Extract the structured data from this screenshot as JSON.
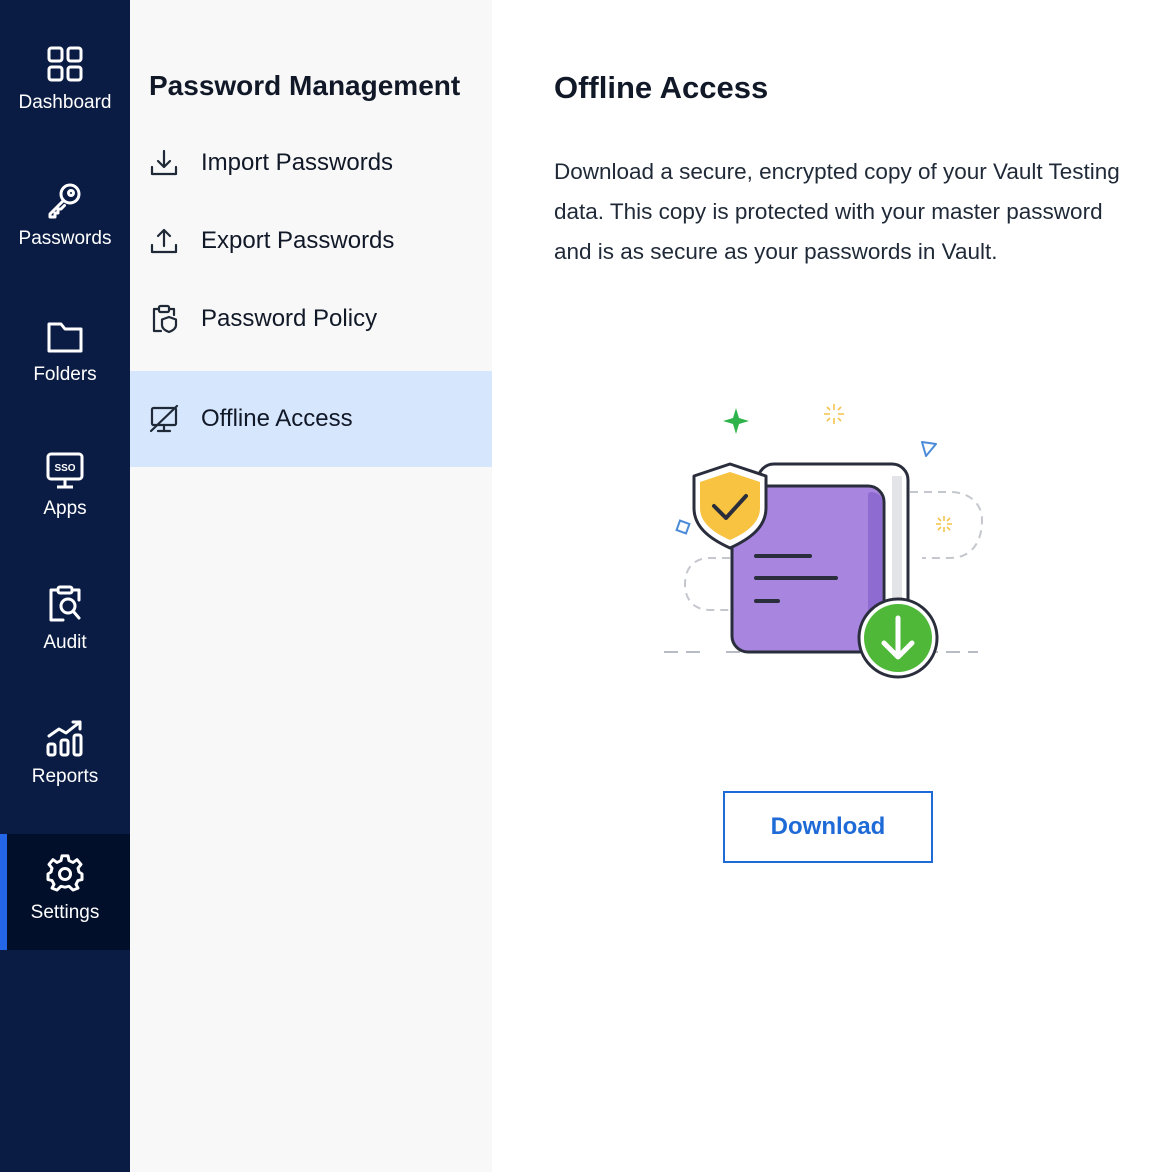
{
  "sidebar": {
    "items": [
      {
        "label": "Dashboard",
        "icon": "dashboard-icon"
      },
      {
        "label": "Passwords",
        "icon": "key-icon"
      },
      {
        "label": "Folders",
        "icon": "folder-icon"
      },
      {
        "label": "Apps",
        "icon": "sso-monitor-icon"
      },
      {
        "label": "Audit",
        "icon": "audit-icon"
      },
      {
        "label": "Reports",
        "icon": "reports-icon"
      },
      {
        "label": "Settings",
        "icon": "gear-icon",
        "active": true
      }
    ]
  },
  "subnav": {
    "title": "Password Management",
    "items": [
      {
        "label": "Import Passwords",
        "icon": "import-icon"
      },
      {
        "label": "Export Passwords",
        "icon": "export-icon"
      },
      {
        "label": "Password Policy",
        "icon": "policy-icon"
      },
      {
        "label": "Offline Access",
        "icon": "offline-monitor-icon",
        "active": true
      }
    ]
  },
  "main": {
    "title": "Offline Access",
    "description": "Download a secure, encrypted copy of your Vault Testing data. This copy is protected with your master password and is as secure as your passwords in Vault.",
    "download_label": "Download",
    "sso_badge": "SSO"
  },
  "colors": {
    "rail_bg": "#0b1c44",
    "rail_active_bg": "#020f2a",
    "rail_active_accent": "#2466e8",
    "subnav_bg": "#f8f8f8",
    "subnav_active_bg": "#d6e6fc",
    "button_accent": "#1e6ad6"
  }
}
